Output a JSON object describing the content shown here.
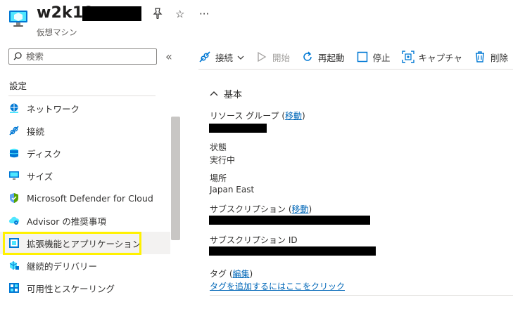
{
  "header": {
    "title": "w2k19",
    "subtitle": "仮想マシン",
    "pin_icon": "pin-icon",
    "favorite_icon": "star-icon",
    "more_icon": "ellipsis-icon"
  },
  "search": {
    "placeholder": "検索"
  },
  "sidebar": {
    "section": "設定",
    "items": [
      {
        "label": "ネットワーク",
        "icon": "network-icon"
      },
      {
        "label": "接続",
        "icon": "connect-icon"
      },
      {
        "label": "ディスク",
        "icon": "disk-icon"
      },
      {
        "label": "サイズ",
        "icon": "size-icon"
      },
      {
        "label": "Microsoft Defender for Cloud",
        "icon": "defender-shield-icon"
      },
      {
        "label": "Advisor の推奨事項",
        "icon": "advisor-cloud-icon"
      },
      {
        "label": "拡張機能とアプリケーション",
        "icon": "extensions-icon",
        "selected": true
      },
      {
        "label": "継続的デリバリー",
        "icon": "continuous-delivery-icon"
      },
      {
        "label": "可用性とスケーリング",
        "icon": "availability-icon"
      }
    ]
  },
  "toolbar": {
    "connect": "接続",
    "start": "開始",
    "restart": "再起動",
    "stop": "停止",
    "capture": "キャプチャ",
    "delete": "削除"
  },
  "essentials": {
    "header": "基本",
    "resource_group_label": "リソース グループ",
    "move_link": "移動",
    "status_label": "状態",
    "status_value": "実行中",
    "location_label": "場所",
    "location_value": "Japan East",
    "subscription_label": "サブスクリプション",
    "subscription_id_label": "サブスクリプション ID",
    "tags_label": "タグ",
    "edit_link": "編集",
    "add_tags_link": "タグを追加するにはここをクリック",
    "open_paren": "(",
    "close_paren": ")"
  },
  "colors": {
    "accent": "#0067b8",
    "highlight": "#fff100",
    "selected_bg": "#f3f2f1"
  }
}
